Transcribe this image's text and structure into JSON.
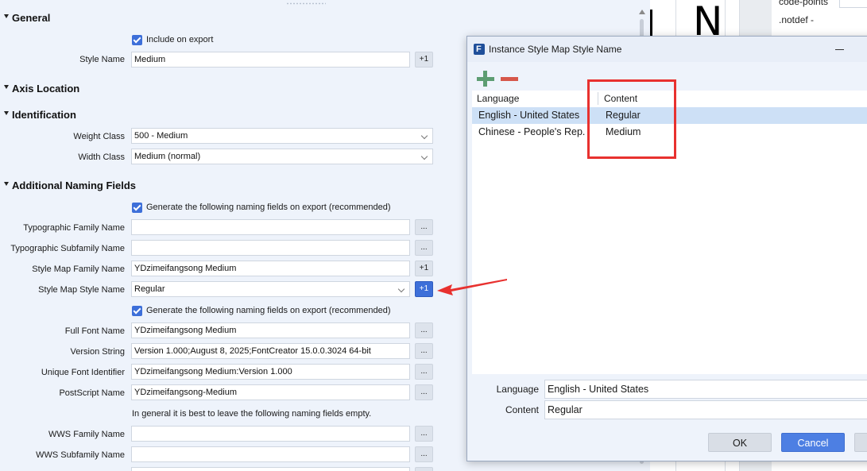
{
  "sections": {
    "general": "General",
    "axis_location": "Axis Location",
    "identification": "Identification",
    "additional": "Additional Naming Fields"
  },
  "general": {
    "include_on_export": "Include on export",
    "style_name_label": "Style Name",
    "style_name_value": "Medium",
    "plus_one": "+1"
  },
  "identification": {
    "weight_class_label": "Weight Class",
    "weight_class_value": "500 - Medium",
    "width_class_label": "Width Class",
    "width_class_value": "Medium (normal)"
  },
  "additional": {
    "generate_label": "Generate the following naming fields on export (recommended)",
    "generate_label_2": "Generate the following naming fields on export (recommended)",
    "note": "In general it is best to leave the following naming fields empty.",
    "ellipsis": "...",
    "plus_one": "+1",
    "fields": {
      "typographic_family": {
        "label": "Typographic Family Name",
        "value": ""
      },
      "typographic_subfamily": {
        "label": "Typographic Subfamily Name",
        "value": ""
      },
      "style_map_family": {
        "label": "Style Map Family Name",
        "value": "YDzimeifangsong Medium"
      },
      "style_map_style": {
        "label": "Style Map Style Name",
        "value": "Regular"
      },
      "full_font_name": {
        "label": "Full Font Name",
        "value": "YDzimeifangsong Medium"
      },
      "version_string": {
        "label": "Version String",
        "value": "Version 1.000;August 8, 2025;FontCreator 15.0.0.3024 64-bit"
      },
      "unique_font_id": {
        "label": "Unique Font Identifier",
        "value": "YDzimeifangsong Medium:Version 1.000"
      },
      "postscript_name": {
        "label": "PostScript Name",
        "value": "YDzimeifangsong-Medium"
      },
      "wws_family": {
        "label": "WWS Family Name",
        "value": ""
      },
      "wws_subfamily": {
        "label": "WWS Subfamily Name",
        "value": ""
      }
    }
  },
  "background": {
    "glyph_char": "N",
    "codepoints": "code-points",
    "notdef": ".notdef -"
  },
  "dialog": {
    "title": "Instance Style Map Style Name",
    "columns": {
      "language": "Language",
      "content": "Content"
    },
    "rows": [
      {
        "language": "English - United States",
        "content": "Regular"
      },
      {
        "language": "Chinese - People's Rep.",
        "content": "Medium"
      }
    ],
    "language_label": "Language",
    "language_value": "English - United States",
    "content_label": "Content",
    "content_value": "Regular",
    "ok": "OK",
    "cancel": "Cancel"
  },
  "colors": {
    "accent": "#3d6fd9",
    "highlight": "#e8312f",
    "add": "#5d9d72",
    "remove": "#d6574a"
  }
}
